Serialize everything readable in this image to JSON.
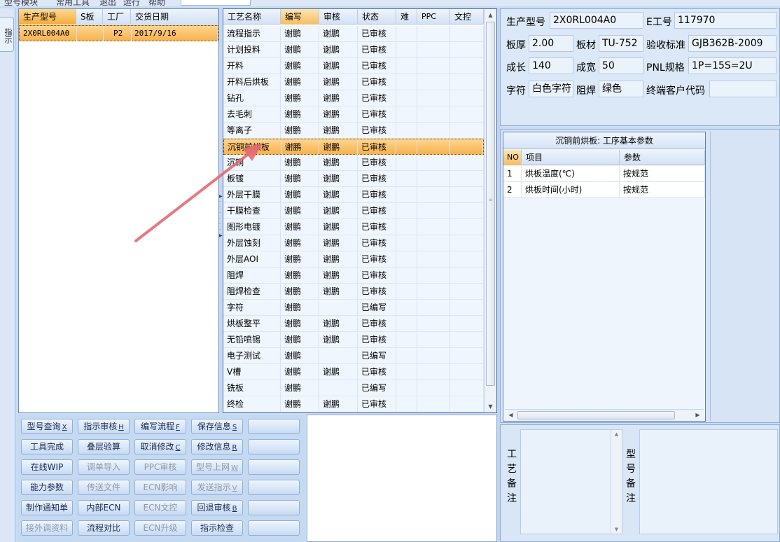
{
  "menubar": {
    "items": [
      "型号模块",
      "常用工具",
      "退出",
      "运行",
      "帮助"
    ]
  },
  "left_strip": {
    "tab_label": "指示"
  },
  "product_grid": {
    "columns": [
      "生产型号",
      "S板",
      "工厂",
      "交货日期"
    ],
    "rows": [
      {
        "model": "2X0RL004A0",
        "s_board": "",
        "factory": "P2",
        "delivery_date": "2017/9/16"
      }
    ]
  },
  "process_grid": {
    "columns": [
      "工艺名称",
      "编写",
      "审核",
      "状态",
      "难",
      "PPC",
      "文控"
    ],
    "rows": [
      {
        "name": "流程指示",
        "writer": "谢鹏",
        "reviewer": "谢鹏",
        "status": "已审核"
      },
      {
        "name": "计划投料",
        "writer": "谢鹏",
        "reviewer": "谢鹏",
        "status": "已审核"
      },
      {
        "name": "开料",
        "writer": "谢鹏",
        "reviewer": "谢鹏",
        "status": "已审核"
      },
      {
        "name": "开料后烘板",
        "writer": "谢鹏",
        "reviewer": "谢鹏",
        "status": "已审核"
      },
      {
        "name": "钻孔",
        "writer": "谢鹏",
        "reviewer": "谢鹏",
        "status": "已审核"
      },
      {
        "name": "去毛刺",
        "writer": "谢鹏",
        "reviewer": "谢鹏",
        "status": "已审核"
      },
      {
        "name": "等离子",
        "writer": "谢鹏",
        "reviewer": "谢鹏",
        "status": "已审核"
      },
      {
        "name": "沉铜前烘板",
        "writer": "谢鹏",
        "reviewer": "谢鹏",
        "status": "已审核",
        "selected": true
      },
      {
        "name": "沉铜",
        "writer": "谢鹏",
        "reviewer": "谢鹏",
        "status": "已审核"
      },
      {
        "name": "板镀",
        "writer": "谢鹏",
        "reviewer": "谢鹏",
        "status": "已审核"
      },
      {
        "name": "外层干膜",
        "writer": "谢鹏",
        "reviewer": "谢鹏",
        "status": "已审核"
      },
      {
        "name": "干膜检查",
        "writer": "谢鹏",
        "reviewer": "谢鹏",
        "status": "已审核"
      },
      {
        "name": "图形电镀",
        "writer": "谢鹏",
        "reviewer": "谢鹏",
        "status": "已审核"
      },
      {
        "name": "外层蚀刻",
        "writer": "谢鹏",
        "reviewer": "谢鹏",
        "status": "已审核"
      },
      {
        "name": "外层AOI",
        "writer": "谢鹏",
        "reviewer": "谢鹏",
        "status": "已审核"
      },
      {
        "name": "阻焊",
        "writer": "谢鹏",
        "reviewer": "谢鹏",
        "status": "已审核"
      },
      {
        "name": "阻焊检查",
        "writer": "谢鹏",
        "reviewer": "谢鹏",
        "status": "已审核"
      },
      {
        "name": "字符",
        "writer": "谢鹏",
        "reviewer": "",
        "status": "已编写"
      },
      {
        "name": "烘板整平",
        "writer": "谢鹏",
        "reviewer": "谢鹏",
        "status": "已审核"
      },
      {
        "name": "无铅喷锡",
        "writer": "谢鹏",
        "reviewer": "谢鹏",
        "status": "已审核"
      },
      {
        "name": "电子测试",
        "writer": "谢鹏",
        "reviewer": "",
        "status": "已编写"
      },
      {
        "name": "V槽",
        "writer": "谢鹏",
        "reviewer": "谢鹏",
        "status": "已审核"
      },
      {
        "name": "铣板",
        "writer": "谢鹏",
        "reviewer": "",
        "status": "已编写"
      },
      {
        "name": "终检",
        "writer": "谢鹏",
        "reviewer": "谢鹏",
        "status": "已审核"
      }
    ]
  },
  "info": {
    "model_label": "生产型号",
    "model_value": "2X0RL004A0",
    "e_no_label": "E工号",
    "e_no_value": "117970",
    "thickness_label": "板厚",
    "thickness_value": "2.00",
    "material_label": "板材",
    "material_value": "TU-752",
    "standard_label": "验收标准",
    "standard_value": "GJB362B-2009",
    "length_label": "成长",
    "length_value": "140",
    "width_label": "成宽",
    "width_value": "50",
    "pnl_label": "PNL规格",
    "pnl_value": "1P=15S=2U",
    "char_label": "字符",
    "char_value": "白色字符",
    "mask_label": "阻焊",
    "mask_value": "绿色",
    "customer_label": "终端客户代码",
    "customer_value": ""
  },
  "params": {
    "title": "沉铜前烘板: 工序基本参数",
    "columns": [
      "NO",
      "项目",
      "参数"
    ],
    "rows": [
      {
        "no": "1",
        "item": "烘板温度(℃)",
        "value": "按规范"
      },
      {
        "no": "2",
        "item": "烘板时间(小时)",
        "value": "按规范"
      }
    ]
  },
  "remarks": {
    "process_label": "工艺备注",
    "model_label": "型号备注"
  },
  "buttons": [
    {
      "label": "型号查询",
      "key": "X",
      "enabled": true
    },
    {
      "label": "指示审核",
      "key": "H",
      "enabled": true
    },
    {
      "label": "编写流程",
      "key": "F",
      "enabled": true
    },
    {
      "label": "保存信息",
      "key": "S",
      "enabled": true
    },
    {
      "label": "",
      "key": "",
      "enabled": true
    },
    {
      "label": "工具完成",
      "key": "",
      "enabled": true
    },
    {
      "label": "叠层验算",
      "key": "",
      "enabled": true
    },
    {
      "label": "取消修改",
      "key": "C",
      "enabled": true
    },
    {
      "label": "修改信息",
      "key": "R",
      "enabled": true
    },
    {
      "label": "",
      "key": "",
      "enabled": true
    },
    {
      "label": "在线WIP",
      "key": "",
      "enabled": true
    },
    {
      "label": "调单导入",
      "key": "",
      "enabled": false
    },
    {
      "label": "PPC审核",
      "key": "",
      "enabled": false
    },
    {
      "label": "型号上网",
      "key": "W",
      "enabled": false
    },
    {
      "label": "",
      "key": "",
      "enabled": true
    },
    {
      "label": "能力参数",
      "key": "",
      "enabled": true
    },
    {
      "label": "传送文件",
      "key": "",
      "enabled": false
    },
    {
      "label": "ECN影响",
      "key": "",
      "enabled": false
    },
    {
      "label": "发送指示",
      "key": "V",
      "enabled": false
    },
    {
      "label": "",
      "key": "",
      "enabled": true
    },
    {
      "label": "制作通知单",
      "key": "",
      "enabled": true
    },
    {
      "label": "内部ECN",
      "key": "",
      "enabled": true
    },
    {
      "label": "ECN文控",
      "key": "",
      "enabled": false
    },
    {
      "label": "回退审核",
      "key": "B",
      "enabled": true
    },
    {
      "label": "",
      "key": "",
      "enabled": true
    },
    {
      "label": "接外调资料",
      "key": "",
      "enabled": false
    },
    {
      "label": "流程对比",
      "key": "",
      "enabled": true
    },
    {
      "label": "ECN升级",
      "key": "",
      "enabled": false
    },
    {
      "label": "指示检查",
      "key": "",
      "enabled": true
    },
    {
      "label": "",
      "key": "",
      "enabled": true
    }
  ],
  "colors": {
    "selection": "#f7b24e",
    "annotation_arrow": "#e46a72",
    "panel_bg": "#c9dcf3"
  }
}
